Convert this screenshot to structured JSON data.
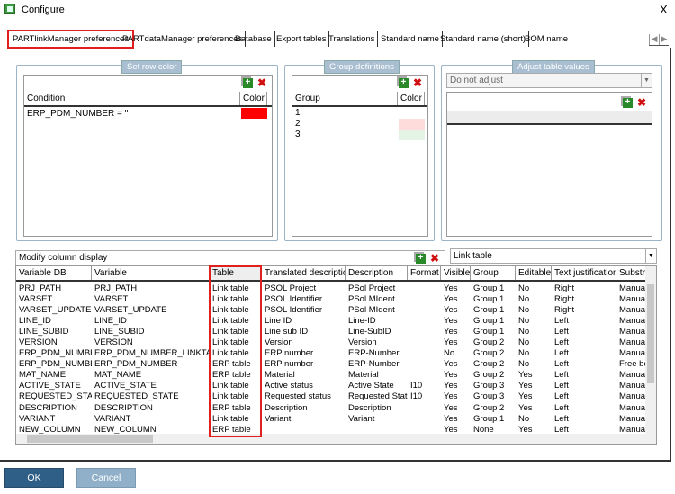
{
  "window": {
    "title": "Configure",
    "close": "X"
  },
  "tabs": [
    "PARTlinkManager preferences",
    "PARTdataManager preferences",
    "Database",
    "Export tables",
    "Translations",
    "Standard name",
    "Standard name (short)",
    "BOM name"
  ],
  "row_color": {
    "label": "Set row color",
    "headers": [
      "Condition",
      "Color"
    ],
    "rows": [
      {
        "condition": "ERP_PDM_NUMBER = ''",
        "color": "#ff0000"
      }
    ]
  },
  "group_defs": {
    "label": "Group definitions",
    "headers": [
      "Group",
      "Color"
    ],
    "rows": [
      {
        "group": "1",
        "color": "#ffffff"
      },
      {
        "group": "2",
        "color": "#ffdcdc"
      },
      {
        "group": "3",
        "color": "#e4f4e4"
      }
    ]
  },
  "adjust": {
    "label": "Adjust table values",
    "select": "Do not adjust"
  },
  "columns": {
    "label": "Modify column display",
    "table_select": "Link table",
    "headers": [
      "Variable DB",
      "Variable",
      "Table",
      "Translated description",
      "Description",
      "Format",
      "Visible",
      "Group",
      "Editable",
      "Text justification",
      "Substri"
    ],
    "rows": [
      [
        "PRJ_PATH",
        "PRJ_PATH",
        "Link table",
        "PSOL Project",
        "PSol Project",
        "",
        "Yes",
        "Group 1",
        "No",
        "Right",
        "Manual"
      ],
      [
        "VARSET",
        "VARSET",
        "Link table",
        "PSOL Identifier",
        "PSol MIdent",
        "",
        "Yes",
        "Group 1",
        "No",
        "Right",
        "Manual"
      ],
      [
        "VARSET_UPDATE",
        "VARSET_UPDATE",
        "Link table",
        "PSOL Identifier",
        "PSol MIdent",
        "",
        "Yes",
        "Group 1",
        "No",
        "Right",
        "Manual"
      ],
      [
        "LINE_ID",
        "LINE_ID",
        "Link table",
        "Line ID",
        "Line-ID",
        "",
        "Yes",
        "Group 1",
        "No",
        "Left",
        "Manual"
      ],
      [
        "LINE_SUBID",
        "LINE_SUBID",
        "Link table",
        "Line sub ID",
        "Line-SubID",
        "",
        "Yes",
        "Group 1",
        "No",
        "Left",
        "Manual"
      ],
      [
        "VERSION",
        "VERSION",
        "Link table",
        "Version",
        "Version",
        "",
        "Yes",
        "Group 2",
        "No",
        "Left",
        "Manual"
      ],
      [
        "ERP_PDM_NUMBER",
        "ERP_PDM_NUMBER_LINKTABLE",
        "Link table",
        "ERP number",
        "ERP-Number",
        "",
        "No",
        "Group 2",
        "No",
        "Left",
        "Manual"
      ],
      [
        "ERP_PDM_NUMBER",
        "ERP_PDM_NUMBER",
        "ERP table",
        "ERP number",
        "ERP-Number",
        "",
        "Yes",
        "Group 2",
        "No",
        "Left",
        "Free bo"
      ],
      [
        "MAT_NAME",
        "MAT_NAME",
        "ERP table",
        "Material",
        "Material",
        "",
        "Yes",
        "Group 2",
        "Yes",
        "Left",
        "Manual"
      ],
      [
        "ACTIVE_STATE",
        "ACTIVE_STATE",
        "Link table",
        "Active status",
        "Active State",
        "I10",
        "Yes",
        "Group 3",
        "Yes",
        "Left",
        "Manual"
      ],
      [
        "REQUESTED_STATE",
        "REQUESTED_STATE",
        "Link table",
        "Requested status",
        "Requested State",
        "I10",
        "Yes",
        "Group 3",
        "Yes",
        "Left",
        "Manual"
      ],
      [
        "DESCRIPTION",
        "DESCRIPTION",
        "ERP table",
        "Description",
        "Description",
        "",
        "Yes",
        "Group 2",
        "Yes",
        "Left",
        "Manual"
      ],
      [
        "VARIANT",
        "VARIANT",
        "Link table",
        "Variant",
        "Variant",
        "",
        "Yes",
        "Group 1",
        "No",
        "Left",
        "Manual"
      ],
      [
        "NEW_COLUMN",
        "NEW_COLUMN",
        "ERP table",
        "",
        "",
        "",
        "Yes",
        "None",
        "Yes",
        "Left",
        "Manual"
      ]
    ]
  },
  "buttons": {
    "ok": "OK",
    "cancel": "Cancel"
  },
  "colors": {
    "highlight": "#e02020",
    "ok": "#2f5f86",
    "cancel": "#8fb0c8"
  }
}
